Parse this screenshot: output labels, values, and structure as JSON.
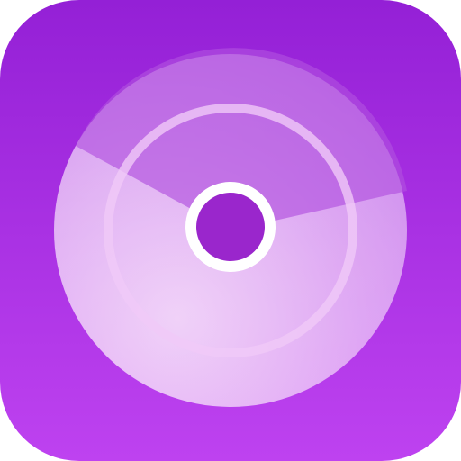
{
  "icon": {
    "semantic": "music-disc-icon",
    "colors": {
      "background_top": "#9420D6",
      "background_bottom": "#BE42F0",
      "disc_light": "#F1D2F8",
      "disc_outer_overlay": "#FFFFFF",
      "ring_stroke": "#F0C9F7",
      "hole_ring": "#FFFFFF",
      "hole_center": "#9A26CC"
    }
  }
}
